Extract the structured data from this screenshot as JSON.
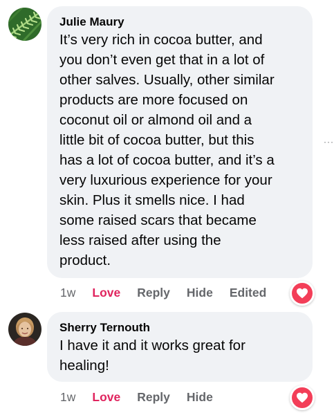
{
  "comments": [
    {
      "author": "Julie Maury",
      "text": "It’s very rich in cocoa butter, and\nyou don’t even get that in a lot of\nother salves. Usually, other similar\nproducts are more focused on\ncoconut oil or almond oil and a\nlittle bit of cocoa butter, but this\nhas a lot of cocoa butter, and it’s a\nvery luxurious experience for your\nskin. Plus it smells nice. I had\nsome raised scars that became\nless raised after using the\nproduct.",
      "time": "1w",
      "reaction_label": "Love",
      "reply_label": "Reply",
      "hide_label": "Hide",
      "edited_label": "Edited",
      "avatar_icon": "fern-leaf-photo",
      "reaction_icon": "heart-icon"
    },
    {
      "author": "Sherry Ternouth",
      "text": "I have it and it works great for\nhealing!",
      "time": "1w",
      "reaction_label": "Love",
      "reply_label": "Reply",
      "hide_label": "Hide",
      "avatar_icon": "profile-photo",
      "reaction_icon": "heart-icon"
    }
  ],
  "more_options": "···",
  "colors": {
    "bubble": "#f0f2f5",
    "love": "#e0245e",
    "heart": "#f33e58",
    "meta": "#65676b"
  }
}
